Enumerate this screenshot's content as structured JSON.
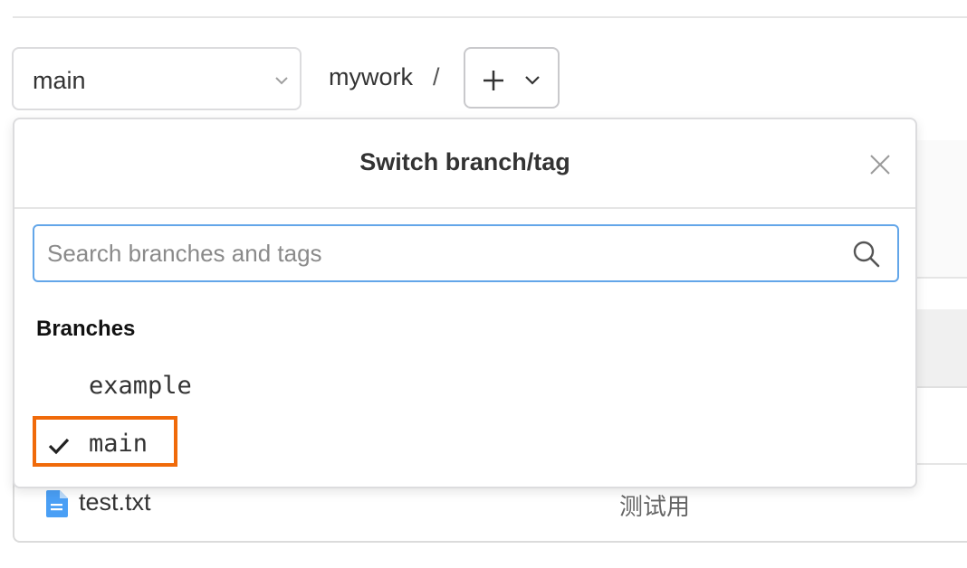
{
  "toolbar": {
    "branch_select_value": "main",
    "path_name": "mywork",
    "path_separator": "/"
  },
  "dropdown": {
    "title": "Switch branch/tag",
    "search_placeholder": "Search branches and tags",
    "search_value": "",
    "section_label": "Branches",
    "branches": [
      {
        "label": "example",
        "selected": false
      },
      {
        "label": "main",
        "selected": true
      }
    ]
  },
  "files": [
    {
      "name": "test.txt",
      "message": "测试用"
    }
  ],
  "colors": {
    "highlight": "#f06a0a",
    "focus_border": "#63a6e9",
    "file_icon": "#4a9ff5"
  }
}
